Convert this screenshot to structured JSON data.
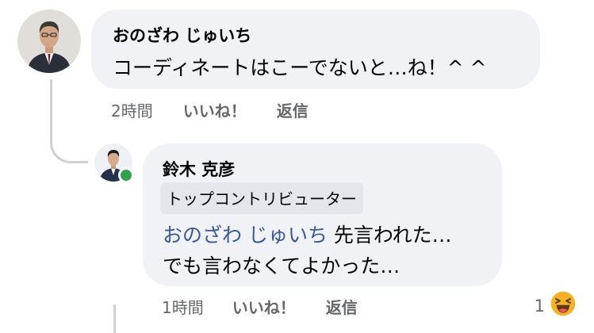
{
  "comment": {
    "author": "おのざわ じゅいち",
    "text": "コーディネートはこーでないと…ね！^ ^",
    "time": "2時間",
    "like_label": "いいね！",
    "reply_label": "返信"
  },
  "reply": {
    "author": "鈴木 克彦",
    "badge": "トップコントリビューター",
    "mention": "おのざわ じゅいち",
    "text_line1": " 先言われた…",
    "text_line2": "でも言わなくてよかった…",
    "time": "1時間",
    "like_label": "いいね！",
    "reply_label": "返信",
    "reaction_count": "1",
    "reaction_icon": "haha-emoji-icon",
    "online": true
  },
  "colors": {
    "bubble": "#f0f2f5",
    "mention": "#385898",
    "meta": "#65676b",
    "online": "#31a24c",
    "reaction": "#f7b125"
  }
}
